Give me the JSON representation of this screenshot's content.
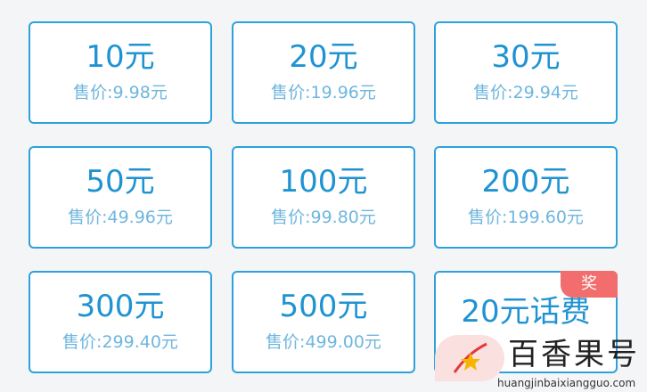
{
  "tiles": [
    {
      "amount": "10元",
      "price": "售价:9.98元"
    },
    {
      "amount": "20元",
      "price": "售价:19.96元"
    },
    {
      "amount": "30元",
      "price": "售价:29.94元"
    },
    {
      "amount": "50元",
      "price": "售价:49.96元"
    },
    {
      "amount": "100元",
      "price": "售价:99.80元"
    },
    {
      "amount": "200元",
      "price": "售价:199.60元"
    },
    {
      "amount": "300元",
      "price": "售价:299.40元"
    },
    {
      "amount": "500元",
      "price": "售价:499.00元"
    },
    {
      "amount": "20元话费",
      "badge": "奖"
    }
  ],
  "watermark": {
    "name": "百香果号",
    "url": "huangjinbaixiangguo.com"
  },
  "colors": {
    "tile_border": "#2ea1dc",
    "amount_text": "#1f93d2",
    "price_text": "#6fb6de",
    "badge_bg": "#f26d6d",
    "background": "#f4f5f7"
  }
}
